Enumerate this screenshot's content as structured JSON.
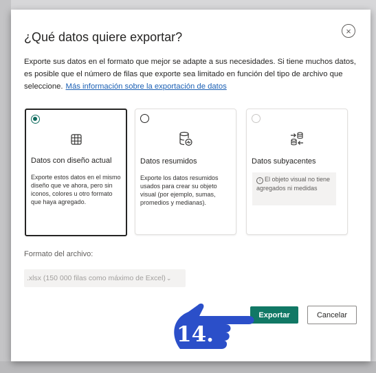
{
  "dialog": {
    "title": "¿Qué datos quiere exportar?",
    "close_label": "×",
    "description": {
      "line1": "Exporte sus datos en el formato que mejor se adapte a sus necesidades. Si tiene muchos datos,",
      "line2": "es posible que el número de filas que exporte sea limitado en función del tipo de archivo que",
      "line3": "seleccione.",
      "link": "Más información sobre la exportación de datos"
    },
    "options": [
      {
        "title": "Datos con diseño actual",
        "description": "Exporte estos datos en el mismo diseño que ve ahora, pero sin iconos, colores u otro formato que haya agregado.",
        "selected": true,
        "enabled": true,
        "icon": "table-grid-icon"
      },
      {
        "title": "Datos resumidos",
        "description": "Exporte los datos resumidos usados para crear su objeto visual (por ejemplo, sumas, promedios y medianas).",
        "selected": false,
        "enabled": true,
        "icon": "database-summary-icon"
      },
      {
        "title": "Datos subyacentes",
        "info_text": "El objeto visual no tiene agregados ni medidas",
        "selected": false,
        "enabled": false,
        "icon": "underlying-data-icon"
      }
    ],
    "format": {
      "label": "Formato del archivo:",
      "value": ".xlsx (150 000 filas como máximo de Excel)",
      "chevron": "⌄"
    },
    "buttons": {
      "export": "Exportar",
      "cancel": "Cancelar"
    }
  },
  "annotation": {
    "step_label": "14.",
    "hand_color": "#2b4fc9"
  },
  "colors": {
    "accent": "#117865",
    "radio_selected": "#0f6b5e",
    "link": "#1a5fb4"
  }
}
